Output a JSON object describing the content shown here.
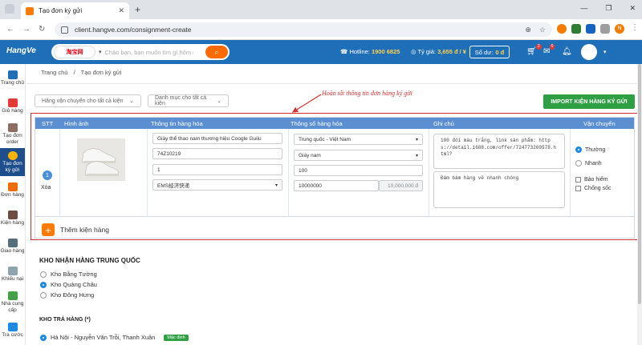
{
  "browser": {
    "tab_title": "Tạo đơn ký gửi",
    "url": "client.hangve.com/consignment-create",
    "profile_initial": "N"
  },
  "header": {
    "logo": "HangVe",
    "search_brand": "淘宝网",
    "search_placeholder": "Chào bạn, bạn muốn tìm gì hôm nay?",
    "hotline_label": "Hotline:",
    "hotline_value": "1900 6825",
    "rate_label": "Tỷ giá:",
    "rate_value": "3,655 đ / ¥",
    "balance_label": "Số dư:",
    "balance_value": "0 đ",
    "cart_count": "2",
    "mail_count": "0"
  },
  "sidebar": {
    "items": [
      {
        "label": "Trang chủ",
        "icon": "home-icon"
      },
      {
        "label": "Giỏ hàng",
        "icon": "cart-icon"
      },
      {
        "label": "Tạo đơn order",
        "icon": "order-icon"
      },
      {
        "label": "Tạo đơn ký gửi",
        "icon": "consign-icon"
      },
      {
        "label": "Đơn hàng",
        "icon": "box-icon"
      },
      {
        "label": "Kiện hàng",
        "icon": "package-icon"
      },
      {
        "label": "Giao hàng",
        "icon": "truck-icon"
      },
      {
        "label": "Khiếu nại",
        "icon": "complaint-icon"
      },
      {
        "label": "Nhà cung cấp",
        "icon": "supplier-icon"
      },
      {
        "label": "Tra cước",
        "icon": "fee-icon"
      }
    ]
  },
  "breadcrumb": {
    "home": "Trang chủ",
    "sep": "/",
    "current": "Tạo đơn ký gửi"
  },
  "filters": {
    "carrier": "Hãng vận chuyển cho tất cả kiện",
    "category": "Danh mục cho tất cả kiện"
  },
  "import_button": "IMPORT KIỆN HÀNG KÝ GỬI",
  "annotation": "Hoàn tất thông tin đơn hàng ký gửi",
  "table": {
    "headers": [
      "STT",
      "Hình ảnh",
      "Thông tin hàng hóa",
      "Thông số hàng hóa",
      "Ghi chú",
      "Vận chuyển"
    ],
    "row": {
      "stt": "1",
      "delete": "Xóa",
      "product_name": "Giày thể thao nam thương hiệu Coogle Guiiu",
      "tracking": "74Z10219",
      "quantity": "1",
      "carrier": "EMS经济快递",
      "route": "Trung quốc - Việt Nam",
      "category": "Giày nam",
      "weight": "100",
      "declared_value": "10000000",
      "declared_vnd": "10,000,000 đ",
      "note_link": "100 đôi màu trắng, link sản phẩm: https://detail.1688.com/offer/724773269578.html?",
      "note_pack": "Đảm bảm hàng về nhanh chóng",
      "ship_normal": "Thường",
      "ship_fast": "Nhanh",
      "insurance": "Bảo hiểm",
      "anti_shock": "Chống sốc"
    },
    "add_label": "Thêm kiện hàng"
  },
  "warehouse_cn": {
    "title": "KHO NHẬN HÀNG TRUNG QUỐC",
    "options": [
      "Kho Bằng Tường",
      "Kho Quảng Châu",
      "Kho Đông Hưng"
    ],
    "selected": 1
  },
  "warehouse_vn": {
    "title": "KHO TRẢ HÀNG (*)",
    "option": "Hà Nội - Nguyễn Văn Trỗi, Thanh Xuân",
    "tag": "Mặc định"
  }
}
